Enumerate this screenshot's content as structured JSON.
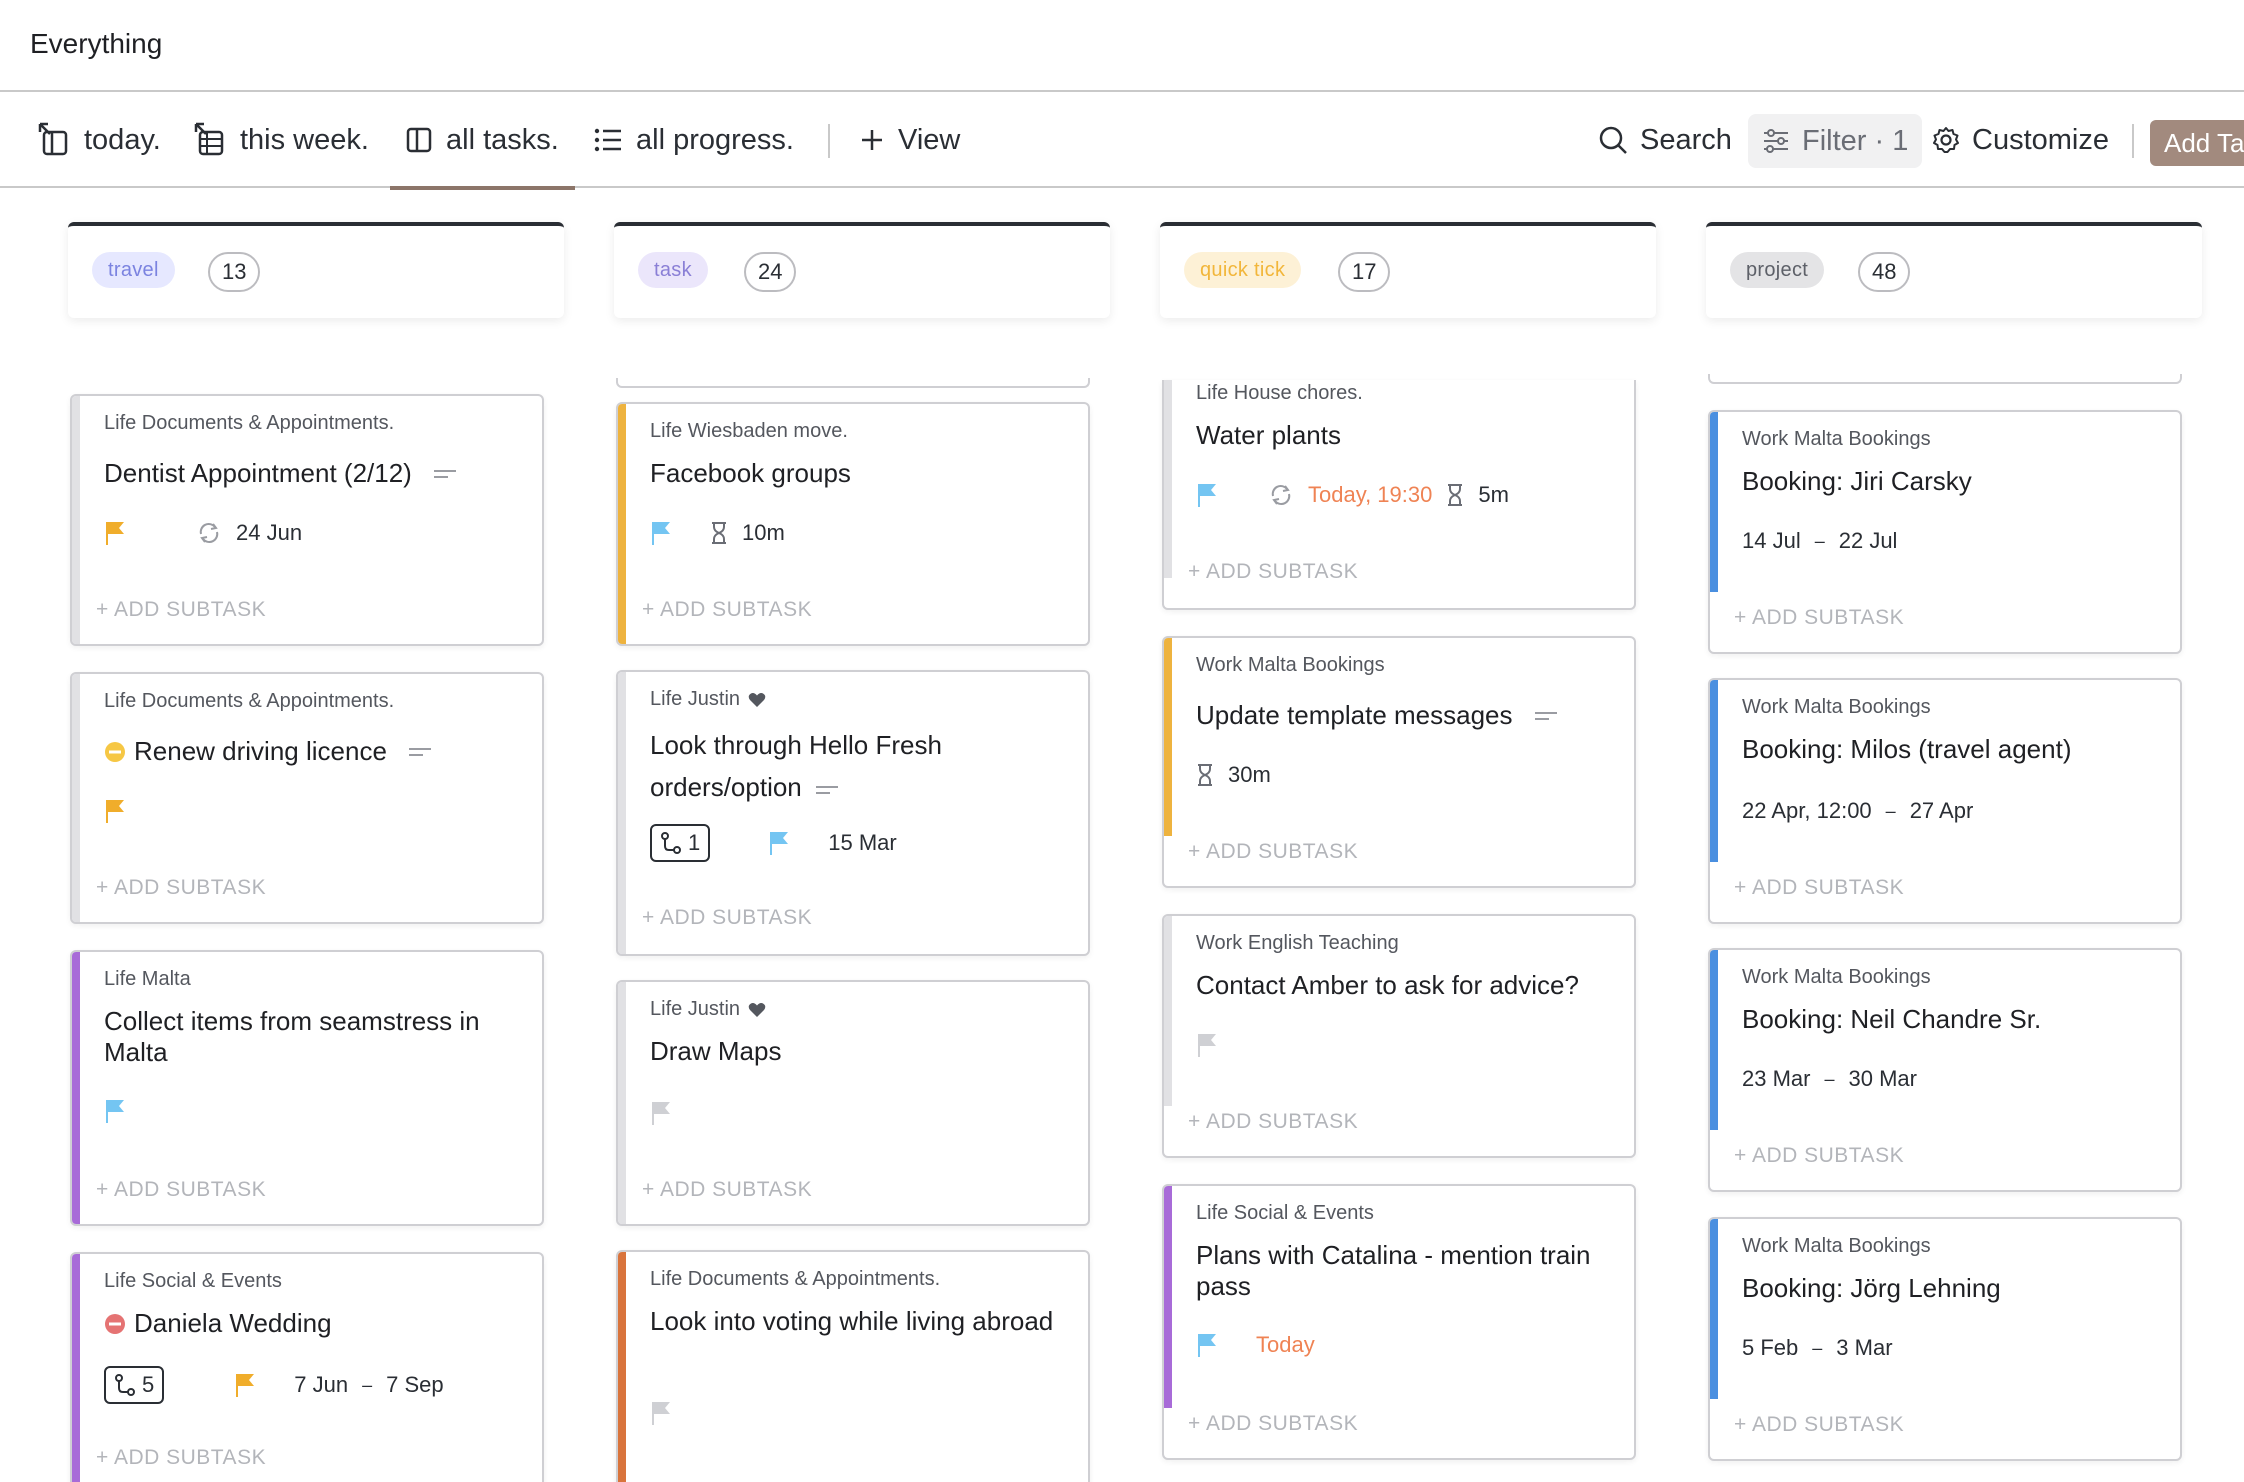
{
  "header": {
    "title": "Everything"
  },
  "views": {
    "today": "today.",
    "this_week": "this week.",
    "all_tasks": "all tasks.",
    "all_progress": "all progress.",
    "add_view": "View"
  },
  "toolbar": {
    "search": "Search",
    "filter": "Filter · 1",
    "customize": "Customize",
    "add_task": "Add Task"
  },
  "subtask_label": "+ ADD SUBTASK",
  "colors": {
    "accent": "#a28a7e",
    "travel_tag_bg": "#e6e8ff",
    "travel_tag_fg": "#7b83e0",
    "task_tag_bg": "#ebe6fb",
    "task_tag_fg": "#8a7fd6",
    "quick_tag_bg": "#fdf1d6",
    "quick_tag_fg": "#f2b63a",
    "project_tag_bg": "#e4e4e6",
    "project_tag_fg": "#5d6068",
    "bar_purple": "#a86bd8",
    "bar_yellow": "#eeb33f",
    "bar_blue": "#4a8fe0",
    "bar_orange": "#d9743c",
    "bar_grey": "#e1e1e4",
    "flag_yellow": "#f0ad2b",
    "flag_blue": "#74c5f2",
    "flag_grey": "#cfd0d4",
    "overdue": "#ef8354"
  },
  "columns": [
    {
      "tag": "travel",
      "count": "13",
      "cards": [
        {
          "list": "Life Documents & Appointments.",
          "name": "Dentist Appointment (2/12)",
          "flag": "yellow-flag-icon",
          "date": "24 Jun"
        },
        {
          "list": "Life Documents & Appointments.",
          "name": "Renew driving licence",
          "status": "in-progress-icon",
          "flag": "yellow-flag-icon"
        },
        {
          "list": "Life Malta",
          "name": "Collect items from seamstress in Malta",
          "flag": "blue-flag-icon"
        },
        {
          "list": "Life Social & Events",
          "name": "Daniela Wedding",
          "status": "blocked-icon",
          "subtasks": "5",
          "start": "7 Jun",
          "end": "7 Sep"
        }
      ]
    },
    {
      "tag": "task",
      "count": "24",
      "cards": [
        {
          "list": "Life Wiesbaden move.",
          "name": "Facebook groups",
          "estimate": "10m"
        },
        {
          "list": "Life Justin",
          "name": "Look through Hello Fresh orders/option",
          "subtasks": "1",
          "date": "15 Mar"
        },
        {
          "list": "Life Justin",
          "name": "Draw Maps"
        },
        {
          "list": "Life Documents & Appointments.",
          "name": "Look into voting while living abroad"
        }
      ]
    },
    {
      "tag": "quick tick",
      "count": "17",
      "cards": [
        {
          "list": "Life House chores.",
          "name": "Water plants",
          "due": "Today, 19:30",
          "estimate": "5m"
        },
        {
          "list": "Work Malta Bookings",
          "name": "Update template messages",
          "estimate": "30m"
        },
        {
          "list": "Work English Teaching",
          "name": "Contact Amber to ask for advice?"
        },
        {
          "list": "Life Social & Events",
          "name": "Plans with Catalina - mention train pass",
          "due": "Today"
        }
      ]
    },
    {
      "tag": "project",
      "count": "48",
      "cards": [
        {
          "list": "Work Malta Bookings",
          "name": "Booking: Jiri Carsky",
          "start": "14 Jul",
          "end": "22 Jul"
        },
        {
          "list": "Work Malta Bookings",
          "name": "Booking: Milos (travel agent)",
          "start": "22 Apr, 12:00",
          "end": "27 Apr"
        },
        {
          "list": "Work Malta Bookings",
          "name": "Booking: Neil Chandre Sr.",
          "start": "23 Mar",
          "end": "30 Mar"
        },
        {
          "list": "Work Malta Bookings",
          "name": "Booking: Jörg Lehning",
          "start": "5 Feb",
          "end": "3 Mar"
        }
      ]
    }
  ]
}
